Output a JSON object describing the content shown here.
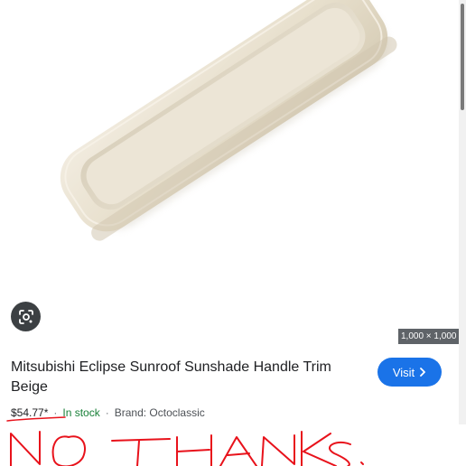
{
  "product": {
    "title": "Mitsubishi Eclipse Sunroof Sunshade Handle Trim Beige",
    "price": "$54.77*",
    "stock": "In stock",
    "brand": "Brand: Octoclassic",
    "separator": "·"
  },
  "image": {
    "dimensions": "1,000 × 1,000"
  },
  "actions": {
    "visit_label": "Visit"
  },
  "annotation": {
    "handwritten_text": "NO THANKS."
  },
  "colors": {
    "accent": "#1a73e8",
    "in_stock": "#188038",
    "handwriting": "#e8121b",
    "product": "#e8dfcc"
  },
  "icons": {
    "lens": "google-lens-icon",
    "visit_arrow": "chevron-right-icon"
  }
}
